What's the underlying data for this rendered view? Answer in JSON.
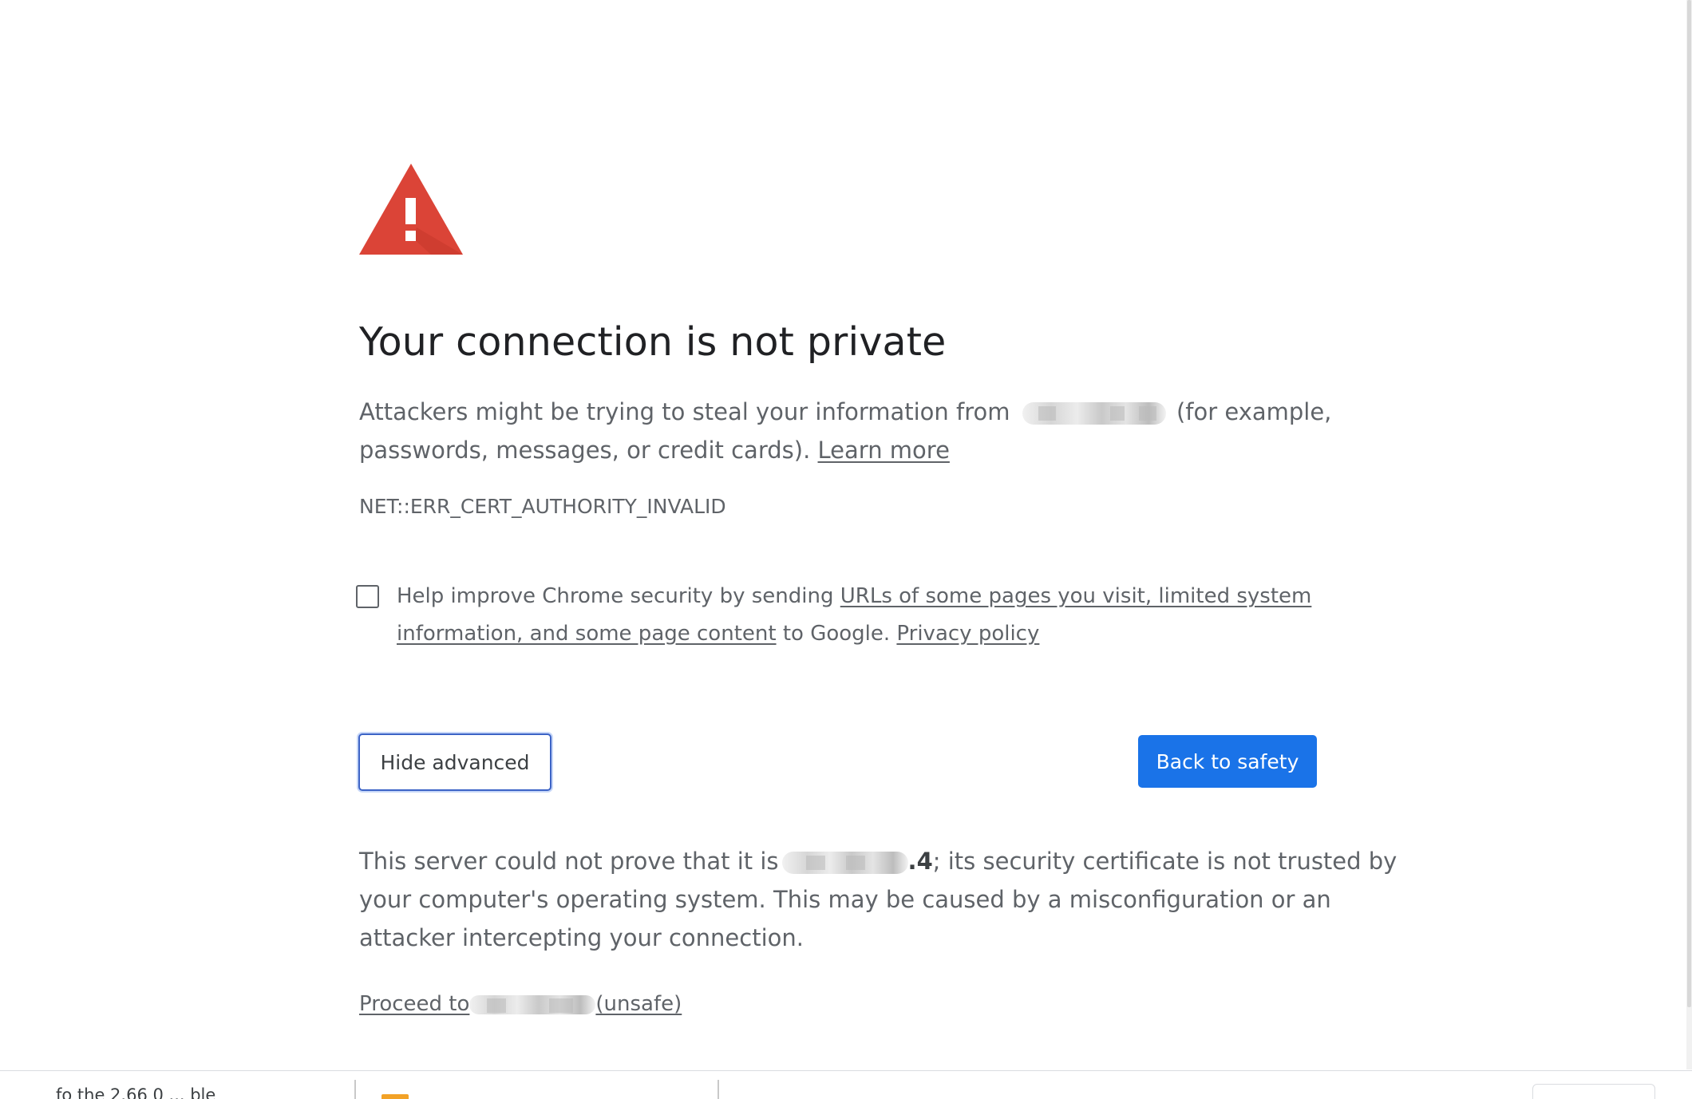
{
  "page": {
    "title": "Your connection is not private",
    "intro_prefix": "Attackers might be trying to steal your information from",
    "intro_suffix_line1": "(for example,",
    "intro_line2_prefix": "passwords, messages, or credit cards).",
    "learn_more": "Learn more",
    "error_code": "NET::ERR_CERT_AUTHORITY_INVALID"
  },
  "report": {
    "text_prefix": "Help improve Chrome security by sending",
    "link_part1": "URLs of some pages you visit, limited system",
    "link_part2": "information, and some page content",
    "text_middle": "to Google.",
    "privacy_link": "Privacy policy"
  },
  "buttons": {
    "hide_advanced": "Hide advanced",
    "back_to_safety": "Back to safety"
  },
  "details": {
    "line1_prefix": "This server could not prove that it is",
    "host_tail": ".4",
    "line1_suffix": "; its security certificate is not trusted by",
    "line2": "your computer's operating system. This may be caused by a misconfiguration or an",
    "line3": "attacker intercepting your connection."
  },
  "proceed": {
    "prefix": "Proceed to",
    "suffix": "(unsafe)"
  },
  "download_shelf": {
    "item1_text": "fo the 2.66 0 ... ble"
  },
  "colors": {
    "warning_red": "#DB4437",
    "primary_blue": "#1A73E8",
    "text_gray": "#5F6368",
    "title_dark": "#202124"
  }
}
